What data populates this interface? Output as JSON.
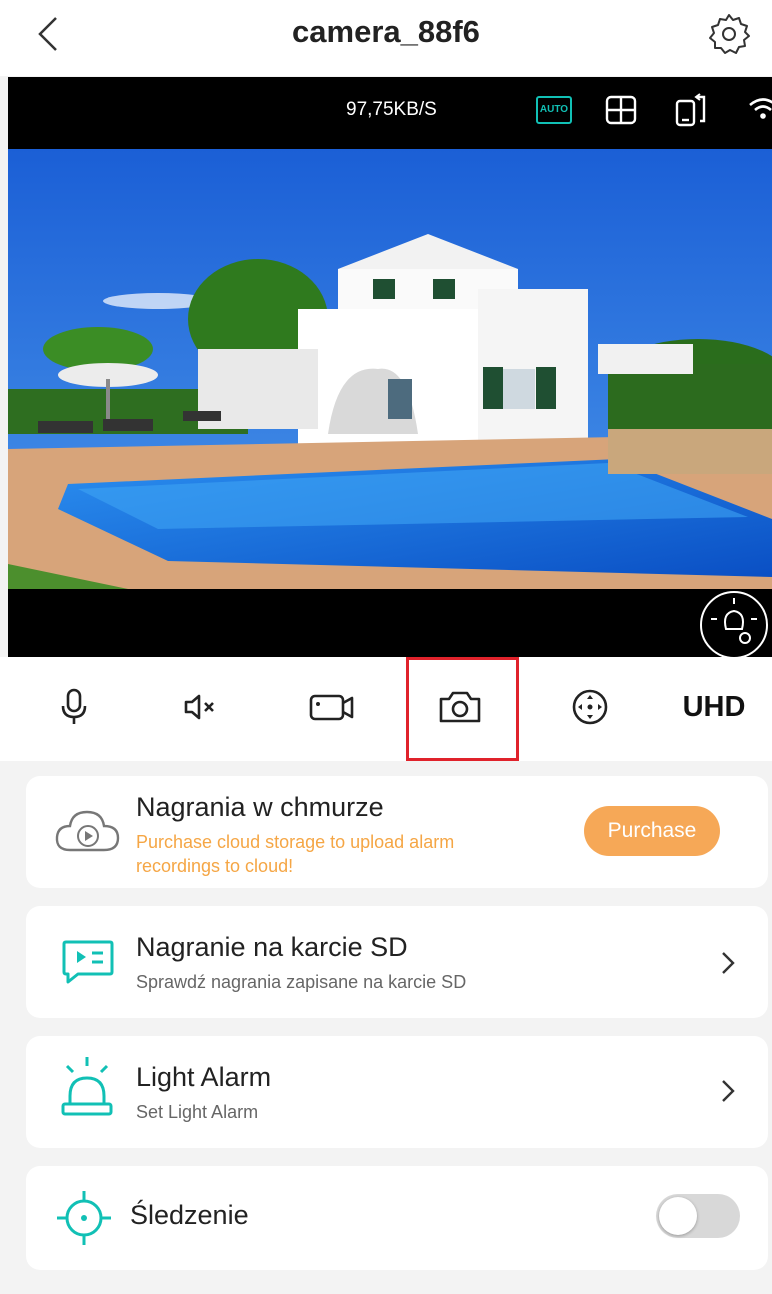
{
  "header": {
    "title": "camera_88f6",
    "back_icon": "chevron-left-icon",
    "settings_icon": "gear-icon"
  },
  "video": {
    "bitrate": "97,75KB/S",
    "auto_label": "AUTO",
    "icons": [
      "auto-quality-icon",
      "grid-icon",
      "screen-rotate-icon",
      "wifi-icon",
      "light-settings-icon"
    ]
  },
  "controls": {
    "icons": [
      "microphone-icon",
      "speaker-muted-icon",
      "video-record-icon",
      "snapshot-camera-icon",
      "ptz-direction-icon"
    ],
    "quality_label": "UHD"
  },
  "cards": {
    "cloud": {
      "title": "Nagrania w chmurze",
      "warning": "Purchase cloud storage to upload alarm recordings to cloud!",
      "button": "Purchase"
    },
    "sd": {
      "title": "Nagranie na karcie SD",
      "subtitle": "Sprawdź nagrania zapisane na karcie SD"
    },
    "light_alarm": {
      "title": "Light Alarm",
      "subtitle": "Set Light Alarm"
    },
    "tracking": {
      "title": "Śledzenie",
      "enabled": false
    }
  },
  "colors": {
    "accent": "#11c0b5",
    "warning": "#f5a645",
    "purchase": "#f6a857",
    "highlight": "#e0222b"
  }
}
